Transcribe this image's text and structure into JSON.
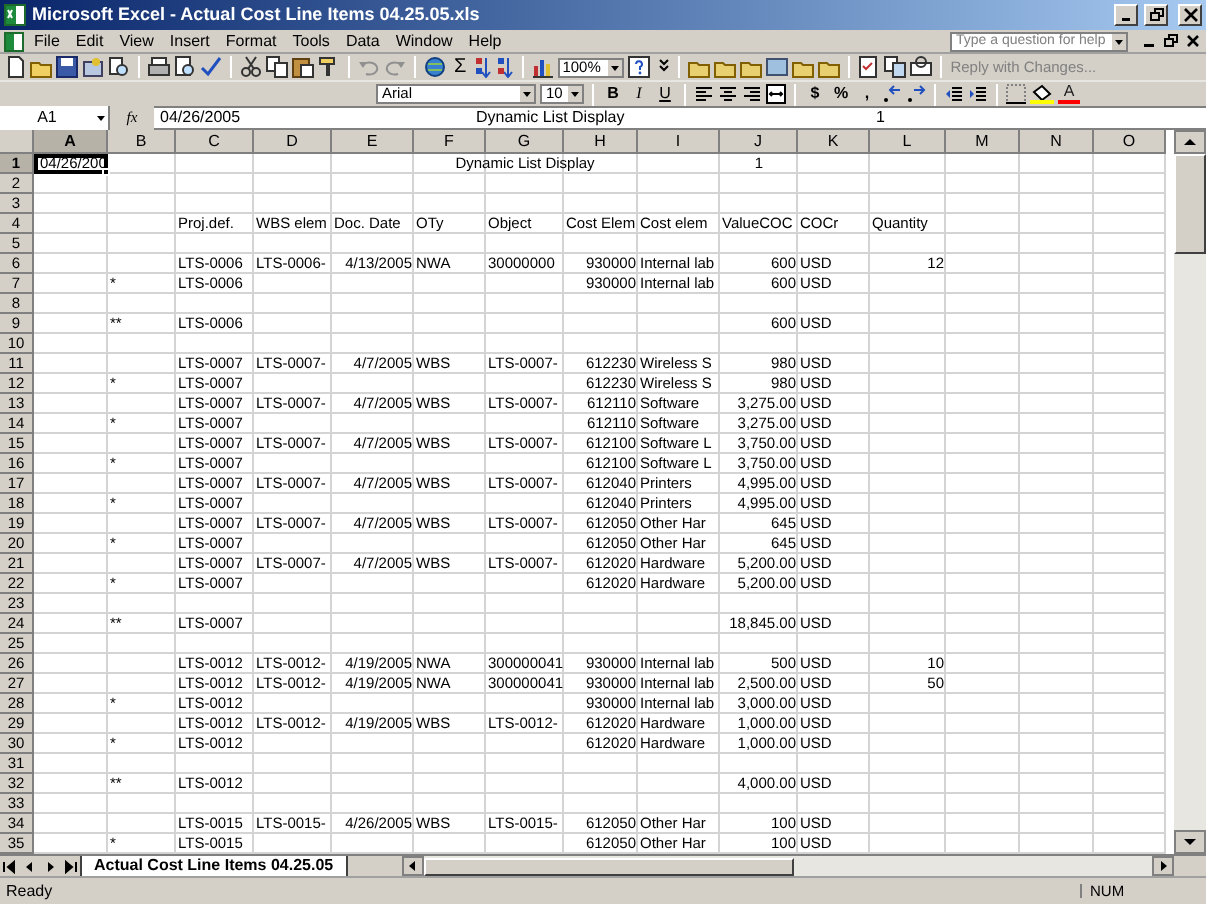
{
  "window": {
    "title": "Microsoft Excel - Actual Cost Line Items 04.25.05.xls"
  },
  "menu": [
    {
      "label": "File"
    },
    {
      "label": "Edit"
    },
    {
      "label": "View"
    },
    {
      "label": "Insert"
    },
    {
      "label": "Format"
    },
    {
      "label": "Tools"
    },
    {
      "label": "Data"
    },
    {
      "label": "Window"
    },
    {
      "label": "Help"
    }
  ],
  "help_box": {
    "placeholder": "Type a question for help"
  },
  "standard_toolbar": {
    "sum": "Σ",
    "zoom": "100%",
    "reply_button": {
      "label": "Reply with Changes...",
      "disabled": true
    }
  },
  "formatting_toolbar": {
    "font": "Arial",
    "size": "10",
    "styles": [
      "B",
      "I",
      "U"
    ],
    "number_formats": [
      "$",
      "%",
      ","
    ],
    "font_color": "A"
  },
  "formula_bar": {
    "name_box": "A1",
    "fx": "fx",
    "segments": [
      "04/26/2005",
      "Dynamic List Display",
      "1"
    ]
  },
  "columns": [
    {
      "label": "A",
      "selected": true
    },
    {
      "label": "B",
      "selected": false
    },
    {
      "label": "C",
      "selected": false
    },
    {
      "label": "D",
      "selected": false
    },
    {
      "label": "E",
      "selected": false
    },
    {
      "label": "F",
      "selected": false
    },
    {
      "label": "G",
      "selected": false
    },
    {
      "label": "H",
      "selected": false
    },
    {
      "label": "I",
      "selected": false
    },
    {
      "label": "J",
      "selected": false
    },
    {
      "label": "K",
      "selected": false
    },
    {
      "label": "L",
      "selected": false
    },
    {
      "label": "M",
      "selected": false
    },
    {
      "label": "N",
      "selected": false
    },
    {
      "label": "O",
      "selected": false
    }
  ],
  "rows": [
    {
      "number": "1",
      "selected": true,
      "cells": {
        "A": {
          "text": "04/26/200",
          "kind": "text"
        },
        "G": {
          "text": "Dynamic List Display",
          "kind": "center"
        },
        "J": {
          "text": "1",
          "kind": "center"
        }
      }
    },
    {
      "number": "2",
      "selected": false
    },
    {
      "number": "3",
      "selected": false
    },
    {
      "number": "4",
      "selected": false,
      "cells": {
        "C": {
          "text": "Proj.def.",
          "kind": "text"
        },
        "D": {
          "text": "WBS elem",
          "kind": "text"
        },
        "E": {
          "text": "Doc. Date",
          "kind": "text"
        },
        "F": {
          "text": "OTy",
          "kind": "text"
        },
        "G": {
          "text": "Object",
          "kind": "text"
        },
        "H": {
          "text": "Cost Elem",
          "kind": "text"
        },
        "I": {
          "text": "Cost elem",
          "kind": "text"
        },
        "J": {
          "text": "ValueCOC",
          "kind": "text"
        },
        "K": {
          "text": "COCr",
          "kind": "text"
        },
        "L": {
          "text": "Quantity",
          "kind": "text"
        }
      }
    },
    {
      "number": "5",
      "selected": false
    },
    {
      "number": "6",
      "selected": false,
      "cells": {
        "C": {
          "text": "LTS-0006",
          "kind": "text"
        },
        "D": {
          "text": "LTS-0006-",
          "kind": "text"
        },
        "E": {
          "text": "4/13/2005",
          "kind": "number"
        },
        "F": {
          "text": "NWA",
          "kind": "text"
        },
        "G": {
          "text": "30000000",
          "kind": "text"
        },
        "H": {
          "text": "930000",
          "kind": "number"
        },
        "I": {
          "text": "Internal lab",
          "kind": "text"
        },
        "J": {
          "text": "600",
          "kind": "number"
        },
        "K": {
          "text": "USD",
          "kind": "text"
        },
        "L": {
          "text": "12",
          "kind": "number"
        }
      }
    },
    {
      "number": "7",
      "selected": false,
      "cells": {
        "B": {
          "text": "*",
          "kind": "text"
        },
        "C": {
          "text": "LTS-0006",
          "kind": "text"
        },
        "H": {
          "text": "930000",
          "kind": "number"
        },
        "I": {
          "text": "Internal lab",
          "kind": "text"
        },
        "J": {
          "text": "600",
          "kind": "number"
        },
        "K": {
          "text": "USD",
          "kind": "text"
        }
      }
    },
    {
      "number": "8",
      "selected": false
    },
    {
      "number": "9",
      "selected": false,
      "cells": {
        "B": {
          "text": "**",
          "kind": "text"
        },
        "C": {
          "text": "LTS-0006",
          "kind": "text"
        },
        "J": {
          "text": "600",
          "kind": "number"
        },
        "K": {
          "text": "USD",
          "kind": "text"
        }
      }
    },
    {
      "number": "10",
      "selected": false
    },
    {
      "number": "11",
      "selected": false,
      "cells": {
        "C": {
          "text": "LTS-0007",
          "kind": "text"
        },
        "D": {
          "text": "LTS-0007-",
          "kind": "text"
        },
        "E": {
          "text": "4/7/2005",
          "kind": "number"
        },
        "F": {
          "text": "WBS",
          "kind": "text"
        },
        "G": {
          "text": "LTS-0007-",
          "kind": "text"
        },
        "H": {
          "text": "612230",
          "kind": "number"
        },
        "I": {
          "text": "Wireless S",
          "kind": "text"
        },
        "J": {
          "text": "980",
          "kind": "number"
        },
        "K": {
          "text": "USD",
          "kind": "text"
        }
      }
    },
    {
      "number": "12",
      "selected": false,
      "cells": {
        "B": {
          "text": "*",
          "kind": "text"
        },
        "C": {
          "text": "LTS-0007",
          "kind": "text"
        },
        "H": {
          "text": "612230",
          "kind": "number"
        },
        "I": {
          "text": "Wireless S",
          "kind": "text"
        },
        "J": {
          "text": "980",
          "kind": "number"
        },
        "K": {
          "text": "USD",
          "kind": "text"
        }
      }
    },
    {
      "number": "13",
      "selected": false,
      "cells": {
        "C": {
          "text": "LTS-0007",
          "kind": "text"
        },
        "D": {
          "text": "LTS-0007-",
          "kind": "text"
        },
        "E": {
          "text": "4/7/2005",
          "kind": "number"
        },
        "F": {
          "text": "WBS",
          "kind": "text"
        },
        "G": {
          "text": "LTS-0007-",
          "kind": "text"
        },
        "H": {
          "text": "612110",
          "kind": "number"
        },
        "I": {
          "text": "Software",
          "kind": "text"
        },
        "J": {
          "text": "3,275.00",
          "kind": "number"
        },
        "K": {
          "text": "USD",
          "kind": "text"
        }
      }
    },
    {
      "number": "14",
      "selected": false,
      "cells": {
        "B": {
          "text": "*",
          "kind": "text"
        },
        "C": {
          "text": "LTS-0007",
          "kind": "text"
        },
        "H": {
          "text": "612110",
          "kind": "number"
        },
        "I": {
          "text": "Software",
          "kind": "text"
        },
        "J": {
          "text": "3,275.00",
          "kind": "number"
        },
        "K": {
          "text": "USD",
          "kind": "text"
        }
      }
    },
    {
      "number": "15",
      "selected": false,
      "cells": {
        "C": {
          "text": "LTS-0007",
          "kind": "text"
        },
        "D": {
          "text": "LTS-0007-",
          "kind": "text"
        },
        "E": {
          "text": "4/7/2005",
          "kind": "number"
        },
        "F": {
          "text": "WBS",
          "kind": "text"
        },
        "G": {
          "text": "LTS-0007-",
          "kind": "text"
        },
        "H": {
          "text": "612100",
          "kind": "number"
        },
        "I": {
          "text": "Software L",
          "kind": "text"
        },
        "J": {
          "text": "3,750.00",
          "kind": "number"
        },
        "K": {
          "text": "USD",
          "kind": "text"
        }
      }
    },
    {
      "number": "16",
      "selected": false,
      "cells": {
        "B": {
          "text": "*",
          "kind": "text"
        },
        "C": {
          "text": "LTS-0007",
          "kind": "text"
        },
        "H": {
          "text": "612100",
          "kind": "number"
        },
        "I": {
          "text": "Software L",
          "kind": "text"
        },
        "J": {
          "text": "3,750.00",
          "kind": "number"
        },
        "K": {
          "text": "USD",
          "kind": "text"
        }
      }
    },
    {
      "number": "17",
      "selected": false,
      "cells": {
        "C": {
          "text": "LTS-0007",
          "kind": "text"
        },
        "D": {
          "text": "LTS-0007-",
          "kind": "text"
        },
        "E": {
          "text": "4/7/2005",
          "kind": "number"
        },
        "F": {
          "text": "WBS",
          "kind": "text"
        },
        "G": {
          "text": "LTS-0007-",
          "kind": "text"
        },
        "H": {
          "text": "612040",
          "kind": "number"
        },
        "I": {
          "text": "Printers",
          "kind": "text"
        },
        "J": {
          "text": "4,995.00",
          "kind": "number"
        },
        "K": {
          "text": "USD",
          "kind": "text"
        }
      }
    },
    {
      "number": "18",
      "selected": false,
      "cells": {
        "B": {
          "text": "*",
          "kind": "text"
        },
        "C": {
          "text": "LTS-0007",
          "kind": "text"
        },
        "H": {
          "text": "612040",
          "kind": "number"
        },
        "I": {
          "text": "Printers",
          "kind": "text"
        },
        "J": {
          "text": "4,995.00",
          "kind": "number"
        },
        "K": {
          "text": "USD",
          "kind": "text"
        }
      }
    },
    {
      "number": "19",
      "selected": false,
      "cells": {
        "C": {
          "text": "LTS-0007",
          "kind": "text"
        },
        "D": {
          "text": "LTS-0007-",
          "kind": "text"
        },
        "E": {
          "text": "4/7/2005",
          "kind": "number"
        },
        "F": {
          "text": "WBS",
          "kind": "text"
        },
        "G": {
          "text": "LTS-0007-",
          "kind": "text"
        },
        "H": {
          "text": "612050",
          "kind": "number"
        },
        "I": {
          "text": "Other Har",
          "kind": "text"
        },
        "J": {
          "text": "645",
          "kind": "number"
        },
        "K": {
          "text": "USD",
          "kind": "text"
        }
      }
    },
    {
      "number": "20",
      "selected": false,
      "cells": {
        "B": {
          "text": "*",
          "kind": "text"
        },
        "C": {
          "text": "LTS-0007",
          "kind": "text"
        },
        "H": {
          "text": "612050",
          "kind": "number"
        },
        "I": {
          "text": "Other Har",
          "kind": "text"
        },
        "J": {
          "text": "645",
          "kind": "number"
        },
        "K": {
          "text": "USD",
          "kind": "text"
        }
      }
    },
    {
      "number": "21",
      "selected": false,
      "cells": {
        "C": {
          "text": "LTS-0007",
          "kind": "text"
        },
        "D": {
          "text": "LTS-0007-",
          "kind": "text"
        },
        "E": {
          "text": "4/7/2005",
          "kind": "number"
        },
        "F": {
          "text": "WBS",
          "kind": "text"
        },
        "G": {
          "text": "LTS-0007-",
          "kind": "text"
        },
        "H": {
          "text": "612020",
          "kind": "number"
        },
        "I": {
          "text": "Hardware",
          "kind": "text"
        },
        "J": {
          "text": "5,200.00",
          "kind": "number"
        },
        "K": {
          "text": "USD",
          "kind": "text"
        }
      }
    },
    {
      "number": "22",
      "selected": false,
      "cells": {
        "B": {
          "text": "*",
          "kind": "text"
        },
        "C": {
          "text": "LTS-0007",
          "kind": "text"
        },
        "H": {
          "text": "612020",
          "kind": "number"
        },
        "I": {
          "text": "Hardware",
          "kind": "text"
        },
        "J": {
          "text": "5,200.00",
          "kind": "number"
        },
        "K": {
          "text": "USD",
          "kind": "text"
        }
      }
    },
    {
      "number": "23",
      "selected": false
    },
    {
      "number": "24",
      "selected": false,
      "cells": {
        "B": {
          "text": "**",
          "kind": "text"
        },
        "C": {
          "text": "LTS-0007",
          "kind": "text"
        },
        "J": {
          "text": "18,845.00",
          "kind": "number"
        },
        "K": {
          "text": "USD",
          "kind": "text"
        }
      }
    },
    {
      "number": "25",
      "selected": false
    },
    {
      "number": "26",
      "selected": false,
      "cells": {
        "C": {
          "text": "LTS-0012",
          "kind": "text"
        },
        "D": {
          "text": "LTS-0012-",
          "kind": "text"
        },
        "E": {
          "text": "4/19/2005",
          "kind": "number"
        },
        "F": {
          "text": "NWA",
          "kind": "text"
        },
        "G": {
          "text": "300000041",
          "kind": "text"
        },
        "H": {
          "text": "930000",
          "kind": "number"
        },
        "I": {
          "text": "Internal lab",
          "kind": "text"
        },
        "J": {
          "text": "500",
          "kind": "number"
        },
        "K": {
          "text": "USD",
          "kind": "text"
        },
        "L": {
          "text": "10",
          "kind": "number"
        }
      }
    },
    {
      "number": "27",
      "selected": false,
      "cells": {
        "C": {
          "text": "LTS-0012",
          "kind": "text"
        },
        "D": {
          "text": "LTS-0012-",
          "kind": "text"
        },
        "E": {
          "text": "4/19/2005",
          "kind": "number"
        },
        "F": {
          "text": "NWA",
          "kind": "text"
        },
        "G": {
          "text": "300000041",
          "kind": "text"
        },
        "H": {
          "text": "930000",
          "kind": "number"
        },
        "I": {
          "text": "Internal lab",
          "kind": "text"
        },
        "J": {
          "text": "2,500.00",
          "kind": "number"
        },
        "K": {
          "text": "USD",
          "kind": "text"
        },
        "L": {
          "text": "50",
          "kind": "number"
        }
      }
    },
    {
      "number": "28",
      "selected": false,
      "cells": {
        "B": {
          "text": "*",
          "kind": "text"
        },
        "C": {
          "text": "LTS-0012",
          "kind": "text"
        },
        "H": {
          "text": "930000",
          "kind": "number"
        },
        "I": {
          "text": "Internal lab",
          "kind": "text"
        },
        "J": {
          "text": "3,000.00",
          "kind": "number"
        },
        "K": {
          "text": "USD",
          "kind": "text"
        }
      }
    },
    {
      "number": "29",
      "selected": false,
      "cells": {
        "C": {
          "text": "LTS-0012",
          "kind": "text"
        },
        "D": {
          "text": "LTS-0012-",
          "kind": "text"
        },
        "E": {
          "text": "4/19/2005",
          "kind": "number"
        },
        "F": {
          "text": "WBS",
          "kind": "text"
        },
        "G": {
          "text": "LTS-0012-",
          "kind": "text"
        },
        "H": {
          "text": "612020",
          "kind": "number"
        },
        "I": {
          "text": "Hardware",
          "kind": "text"
        },
        "J": {
          "text": "1,000.00",
          "kind": "number"
        },
        "K": {
          "text": "USD",
          "kind": "text"
        }
      }
    },
    {
      "number": "30",
      "selected": false,
      "cells": {
        "B": {
          "text": "*",
          "kind": "text"
        },
        "C": {
          "text": "LTS-0012",
          "kind": "text"
        },
        "H": {
          "text": "612020",
          "kind": "number"
        },
        "I": {
          "text": "Hardware",
          "kind": "text"
        },
        "J": {
          "text": "1,000.00",
          "kind": "number"
        },
        "K": {
          "text": "USD",
          "kind": "text"
        }
      }
    },
    {
      "number": "31",
      "selected": false
    },
    {
      "number": "32",
      "selected": false,
      "cells": {
        "B": {
          "text": "**",
          "kind": "text"
        },
        "C": {
          "text": "LTS-0012",
          "kind": "text"
        },
        "J": {
          "text": "4,000.00",
          "kind": "number"
        },
        "K": {
          "text": "USD",
          "kind": "text"
        }
      }
    },
    {
      "number": "33",
      "selected": false
    },
    {
      "number": "34",
      "selected": false,
      "cells": {
        "C": {
          "text": "LTS-0015",
          "kind": "text"
        },
        "D": {
          "text": "LTS-0015-",
          "kind": "text"
        },
        "E": {
          "text": "4/26/2005",
          "kind": "number"
        },
        "F": {
          "text": "WBS",
          "kind": "text"
        },
        "G": {
          "text": "LTS-0015-",
          "kind": "text"
        },
        "H": {
          "text": "612050",
          "kind": "number"
        },
        "I": {
          "text": "Other Har",
          "kind": "text"
        },
        "J": {
          "text": "100",
          "kind": "number"
        },
        "K": {
          "text": "USD",
          "kind": "text"
        }
      }
    },
    {
      "number": "35",
      "selected": false,
      "cells": {
        "B": {
          "text": "*",
          "kind": "text"
        },
        "C": {
          "text": "LTS-0015",
          "kind": "text"
        },
        "H": {
          "text": "612050",
          "kind": "number"
        },
        "I": {
          "text": "Other Har",
          "kind": "text"
        },
        "J": {
          "text": "100",
          "kind": "number"
        },
        "K": {
          "text": "USD",
          "kind": "text"
        }
      }
    }
  ],
  "sheet_tabs": [
    {
      "label": "Actual Cost Line Items 04.25.05",
      "selected": true
    }
  ],
  "status_bar": {
    "status": "Ready",
    "indicator": "NUM"
  }
}
